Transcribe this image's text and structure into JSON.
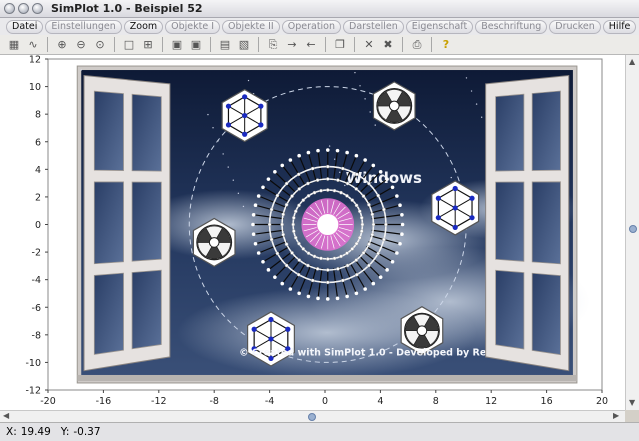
{
  "window": {
    "title": "SimPlot 1.0 - Beispiel 52"
  },
  "menu": {
    "items": [
      {
        "label": "Datei",
        "enabled": true
      },
      {
        "label": "Einstellungen",
        "enabled": false
      },
      {
        "label": "Zoom",
        "enabled": true
      },
      {
        "label": "Objekte I",
        "enabled": false
      },
      {
        "label": "Objekte II",
        "enabled": false
      },
      {
        "label": "Operation",
        "enabled": false
      },
      {
        "label": "Darstellen",
        "enabled": false
      },
      {
        "label": "Eigenschaft",
        "enabled": false
      },
      {
        "label": "Beschriftung",
        "enabled": false
      },
      {
        "label": "Drucken",
        "enabled": false
      },
      {
        "label": "Hilfe",
        "enabled": true
      }
    ]
  },
  "toolbar": {
    "icons": [
      "calculator-icon",
      "function-icon",
      "zoom-in-icon",
      "zoom-out-icon",
      "zoom-fit-icon",
      "square-icon",
      "grid-small-icon",
      "select-a-icon",
      "select-b-icon",
      "table-icon",
      "image-settings-icon",
      "copy-icon",
      "arrow-right-icon",
      "arrow-left-icon",
      "pages-icon",
      "cross-icon",
      "cross-bold-icon",
      "print-icon",
      "help-icon"
    ]
  },
  "plot": {
    "x_ticks": [
      -20,
      -16,
      -12,
      -8,
      -4,
      0,
      4,
      8,
      12,
      16,
      20
    ],
    "y_ticks": [
      12,
      10,
      8,
      6,
      4,
      2,
      0,
      -2,
      -4,
      -6,
      -8,
      -10,
      -12
    ],
    "xlim": [
      -20,
      20
    ],
    "ylim": [
      -12,
      12
    ],
    "overlay_text_windows": "Windows",
    "credit_text": "© Created with SimPlot 1.0 - Developed by ReduSoft",
    "colors": {
      "sky": "#1b2a4a",
      "frame": "#e6e2e0",
      "magenta": "#e070d0",
      "node": "#1a2ac0"
    }
  },
  "status": {
    "x_label": "X:",
    "x_value": "19.49",
    "y_label": "Y:",
    "y_value": "-0.37"
  }
}
